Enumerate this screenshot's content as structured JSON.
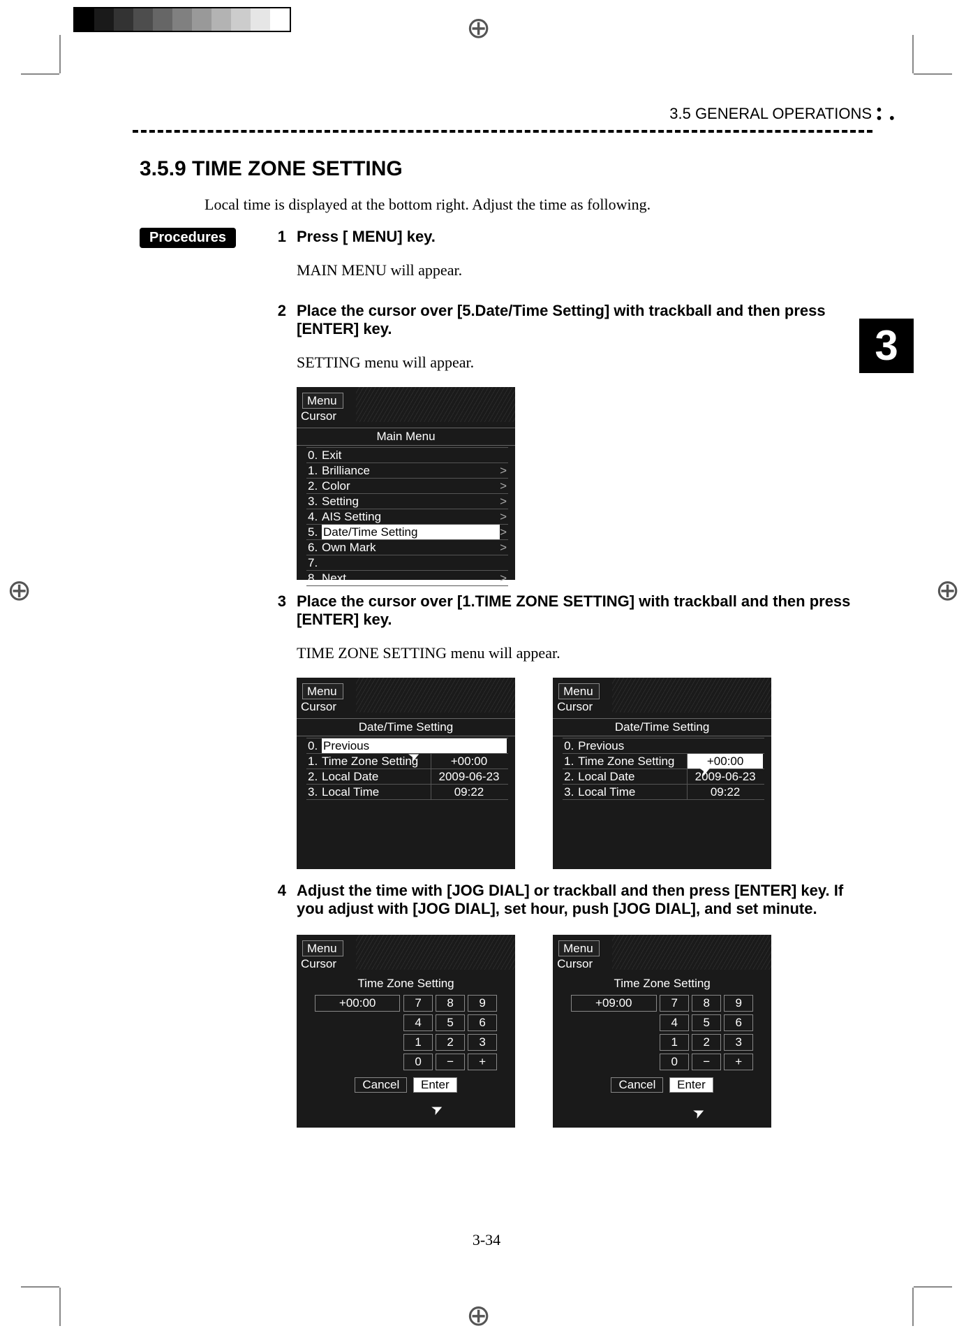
{
  "header": {
    "section": "3.5   GENERAL  OPERATIONS"
  },
  "chapter_tab": "3",
  "section_title": "3.5.9    TIME ZONE SETTING",
  "intro": "Local time is displayed at the bottom right. Adjust the time as following.",
  "procedures_label": "Procedures",
  "page_number": "3-34",
  "steps": {
    "s1": {
      "num": "1",
      "heading": "Press [ MENU] key.",
      "sub": "MAIN MENU will appear."
    },
    "s2": {
      "num": "2",
      "heading": "Place the cursor over [5.Date/Time Setting] with trackball and then press [ENTER] key.",
      "sub": "SETTING menu will appear."
    },
    "s3": {
      "num": "3",
      "heading": "Place the cursor over [1.TIME ZONE SETTING] with trackball and then press [ENTER] key.",
      "sub": "TIME ZONE SETTING menu will appear."
    },
    "s4": {
      "num": "4",
      "heading": "Adjust the time with [JOG DIAL] or trackball and then press [ENTER] key. If you adjust with [JOG DIAL], set hour, push [JOG DIAL], and set minute."
    }
  },
  "radar_common": {
    "menu": "Menu",
    "cursor": "Cursor"
  },
  "main_menu": {
    "title": "Main  Menu",
    "items": {
      "i0": {
        "n": "0.",
        "t": "Exit"
      },
      "i1": {
        "n": "1.",
        "t": "Brilliance",
        "a": ">"
      },
      "i2": {
        "n": "2.",
        "t": "Color",
        "a": ">"
      },
      "i3": {
        "n": "3.",
        "t": "Setting",
        "a": ">"
      },
      "i4": {
        "n": "4.",
        "t": "AIS  Setting",
        "a": ">"
      },
      "i5": {
        "n": "5.",
        "t": "Date/Time  Setting",
        "a": ">"
      },
      "i6": {
        "n": "6.",
        "t": "Own  Mark",
        "a": ">"
      },
      "i7": {
        "n": "7.",
        "t": ""
      },
      "i8": {
        "n": "8.",
        "t": "Next",
        "a": ">"
      }
    }
  },
  "dt_menu": {
    "title": "Date/Time  Setting",
    "items": {
      "i0": {
        "n": "0.",
        "t": "Previous"
      },
      "i1": {
        "n": "1.",
        "t": "Time  Zone  Setting",
        "v": "+00:00"
      },
      "i2": {
        "n": "2.",
        "t": "Local  Date",
        "v": "2009-06-23"
      },
      "i3": {
        "n": "3.",
        "t": "Local  Time",
        "v": "09:22"
      }
    }
  },
  "dt_menu2": {
    "title": "Date/Time  Setting",
    "items": {
      "i0": {
        "n": "0.",
        "t": "Previous"
      },
      "i1": {
        "n": "1.",
        "t": "Time  Zone  Setting",
        "v": "+00:00"
      },
      "i2": {
        "n": "2.",
        "t": "Local  Date",
        "v": "2009-06-23"
      },
      "i3": {
        "n": "3.",
        "t": "Local  Time",
        "v": "09:22"
      }
    }
  },
  "tz_menu": {
    "title": "Time  Zone  Setting",
    "value_a": "+00:00",
    "value_b": "+09:00",
    "keys": {
      "k7": "7",
      "k8": "8",
      "k9": "9",
      "k4": "4",
      "k5": "5",
      "k6": "6",
      "k1": "1",
      "k2": "2",
      "k3": "3",
      "k0": "0",
      "km": "−",
      "kp": "+"
    },
    "cancel": "Cancel",
    "enter": "Enter"
  }
}
